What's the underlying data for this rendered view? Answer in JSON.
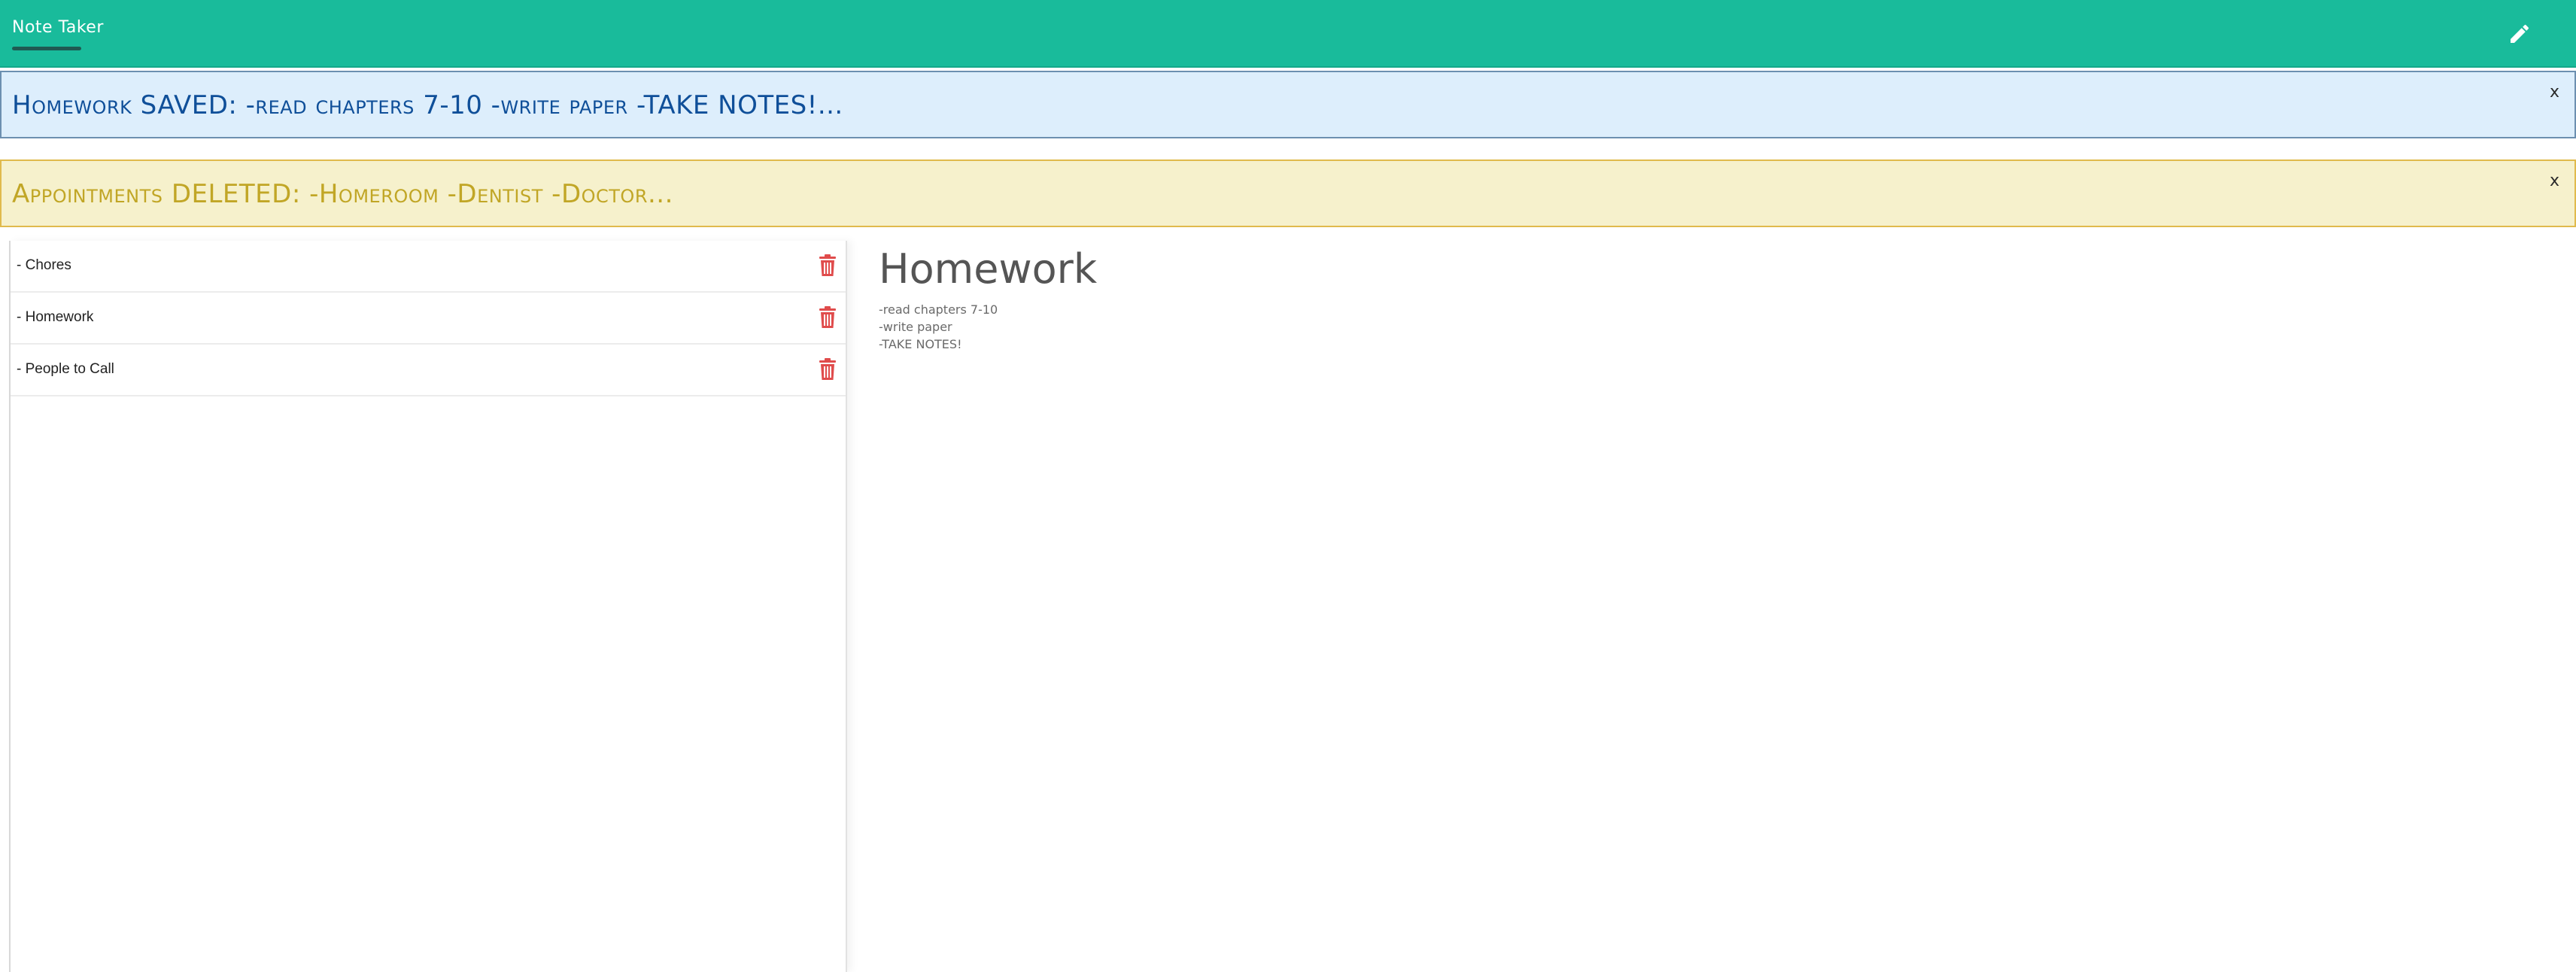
{
  "app": {
    "brand": "Note Taker",
    "accent_color": "#19bb9b",
    "edit_icon": "pencil-icon"
  },
  "alerts": [
    {
      "text": "Homework SAVED: -read chapters 7-10 -write paper -TAKE NOTES!...",
      "close_label": "x",
      "type": "info"
    },
    {
      "text": "Appointments DELETED: -Homeroom -Dentist -Doctor...",
      "close_label": "x",
      "type": "warning"
    }
  ],
  "notes": [
    {
      "title": "- Chores",
      "delete_icon": "trash-icon"
    },
    {
      "title": "- Homework",
      "delete_icon": "trash-icon"
    },
    {
      "title": "- People to Call",
      "delete_icon": "trash-icon"
    }
  ],
  "active_note": {
    "title": "Homework",
    "body": "-read chapters 7-10\n-write paper\n-TAKE NOTES!"
  }
}
